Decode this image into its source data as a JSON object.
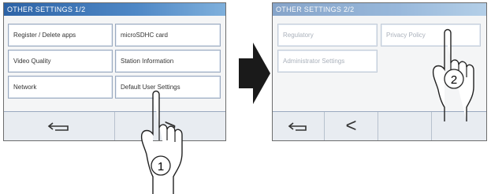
{
  "screen1": {
    "title": "OTHER SETTINGS 1/2",
    "options": [
      "Register / Delete apps",
      "microSDHC card",
      "Video Quality",
      "Station Information",
      "Network",
      "Default User Settings"
    ],
    "nav": {
      "back": "back-arrow",
      "next": ">"
    }
  },
  "screen2": {
    "title": "OTHER SETTINGS 2/2",
    "options": [
      "Regulatory",
      "Privacy Policy",
      "Administrator Settings"
    ],
    "nav": {
      "back": "back-arrow",
      "prev": "<"
    }
  },
  "steps": {
    "step1": "1",
    "step2": "2"
  },
  "colors": {
    "title_bar": "#2d63a6",
    "arrow": "#1a1a1a"
  }
}
